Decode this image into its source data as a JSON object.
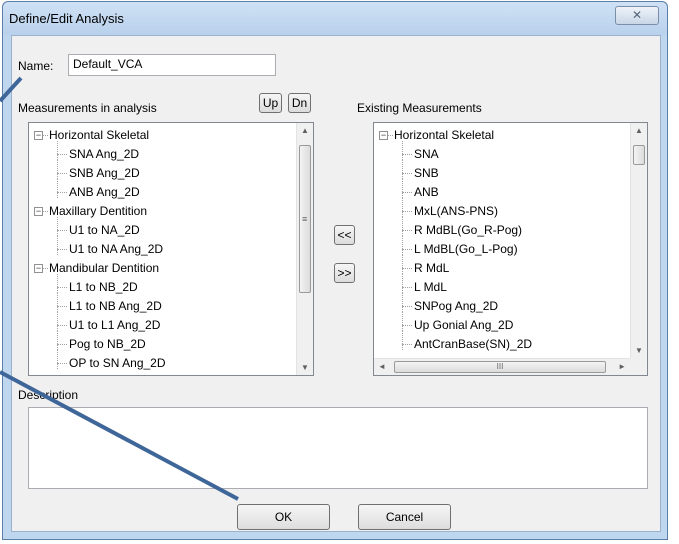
{
  "window": {
    "title": "Define/Edit Analysis",
    "close_glyph": "✕"
  },
  "name_field": {
    "label": "Name:",
    "value": "Default_VCA"
  },
  "analysis": {
    "label": "Measurements in analysis",
    "up_label": "Up",
    "dn_label": "Dn",
    "tree": [
      {
        "text": "Horizontal Skeletal",
        "level": 0,
        "expander": "−"
      },
      {
        "text": "SNA Ang_2D",
        "level": 1
      },
      {
        "text": "SNB Ang_2D",
        "level": 1
      },
      {
        "text": "ANB Ang_2D",
        "level": 1
      },
      {
        "text": "Maxillary Dentition",
        "level": 0,
        "expander": "−"
      },
      {
        "text": "U1 to NA_2D",
        "level": 1
      },
      {
        "text": "U1 to NA Ang_2D",
        "level": 1
      },
      {
        "text": "Mandibular Dentition",
        "level": 0,
        "expander": "−"
      },
      {
        "text": "L1 to NB_2D",
        "level": 1
      },
      {
        "text": "L1 to NB Ang_2D",
        "level": 1
      },
      {
        "text": "U1 to L1 Ang_2D",
        "level": 1
      },
      {
        "text": "Pog to NB_2D",
        "level": 1
      },
      {
        "text": "OP to SN Ang_2D",
        "level": 1
      }
    ]
  },
  "move_buttons": {
    "add_label": "<<",
    "remove_label": ">>"
  },
  "existing": {
    "label": "Existing Measurements",
    "tree": [
      {
        "text": "Horizontal Skeletal",
        "level": 0,
        "expander": "−"
      },
      {
        "text": "SNA",
        "level": 1
      },
      {
        "text": "SNB",
        "level": 1
      },
      {
        "text": "ANB",
        "level": 1
      },
      {
        "text": "MxL(ANS-PNS)",
        "level": 1
      },
      {
        "text": "R MdBL(Go_R-Pog)",
        "level": 1
      },
      {
        "text": "L MdBL(Go_L-Pog)",
        "level": 1
      },
      {
        "text": "R MdL",
        "level": 1
      },
      {
        "text": "L MdL",
        "level": 1
      },
      {
        "text": "SNPog Ang_2D",
        "level": 1
      },
      {
        "text": "Up Gonial Ang_2D",
        "level": 1
      },
      {
        "text": "AntCranBase(SN)_2D",
        "level": 1
      }
    ]
  },
  "scroll": {
    "up": "▲",
    "down": "▼",
    "left": "◄",
    "right": "►",
    "grip_v": "≡",
    "grip_h": "III"
  },
  "description": {
    "label": "Description",
    "value": ""
  },
  "buttons": {
    "ok_label": "OK",
    "cancel_label": "Cancel"
  },
  "colors": {
    "pointer_line": "#3f6699",
    "window_frame": "#bfd6ef"
  }
}
